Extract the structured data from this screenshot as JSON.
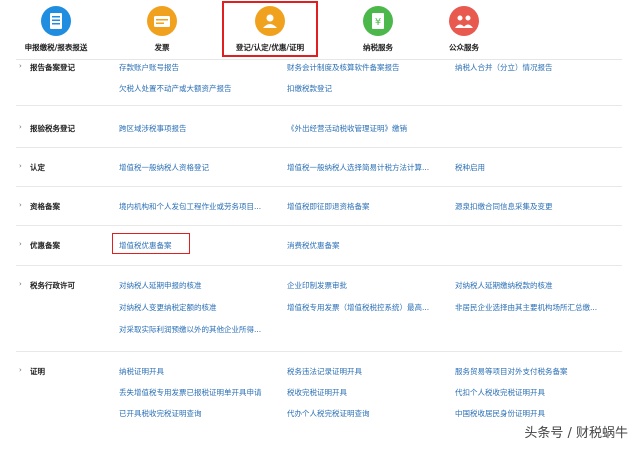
{
  "nav": [
    {
      "label": "申报缴税/报表报送",
      "icon": "tax-declaration-icon",
      "color": "#1f8de0"
    },
    {
      "label": "发票",
      "icon": "invoice-icon",
      "color": "#f0a21e"
    },
    {
      "label": "登记/认定/优惠/证明",
      "icon": "registration-icon",
      "color": "#f0a21e"
    },
    {
      "label": "纳税服务",
      "icon": "tax-service-icon",
      "color": "#4cb84c"
    },
    {
      "label": "公众服务",
      "icon": "public-service-icon",
      "color": "#e85a4f"
    }
  ],
  "sections": [
    {
      "title": "报告备案登记",
      "links": [
        [
          "存款账户账号报告",
          "财务会计制度及核算软件备案报告",
          "纳税人合并（分立）情况报告"
        ],
        [
          "欠税人处置不动产或大额资产报告",
          "扣缴税款登记",
          ""
        ]
      ]
    },
    {
      "title": "报验税务登记",
      "links": [
        [
          "跨区域涉税事项报告",
          "《外出经营活动税收管理证明》缴销",
          ""
        ]
      ]
    },
    {
      "title": "认定",
      "links": [
        [
          "增值税一般纳税人资格登记",
          "增值税一般纳税人选择简易计税方法计算...",
          "税种启用"
        ]
      ]
    },
    {
      "title": "资格备案",
      "links": [
        [
          "境内机构和个人发包工程作业或劳务项目...",
          "增值税即征即退资格备案",
          "源泉扣缴合同信息采集及变更"
        ]
      ]
    },
    {
      "title": "优惠备案",
      "links": [
        [
          "增值税优惠备案",
          "消费税优惠备案",
          ""
        ]
      ]
    },
    {
      "title": "税务行政许可",
      "links": [
        [
          "对纳税人延期申报的核准",
          "企业印制发票审批",
          "对纳税人延期缴纳税款的核准"
        ],
        [
          "对纳税人变更纳税定额的核准",
          "增值税专用发票（增值税税控系统）最高...",
          "非居民企业选择由其主要机构场所汇总缴..."
        ],
        [
          "对采取实际利润预缴以外的其他企业所得...",
          "",
          ""
        ]
      ]
    },
    {
      "title": "证明",
      "links": [
        [
          "纳税证明开具",
          "税务违法记录证明开具",
          "服务贸易等项目对外支付税务备案"
        ],
        [
          "丢失增值税专用发票已报税证明单开具申请",
          "税收完税证明开具",
          "代扣个人税收完税证明开具"
        ],
        [
          "已开具税收完税证明查询",
          "代办个人税完税证明查询",
          "中国税收居民身份证明开具"
        ]
      ]
    }
  ],
  "watermark": "头条号 / 财税蜗牛"
}
